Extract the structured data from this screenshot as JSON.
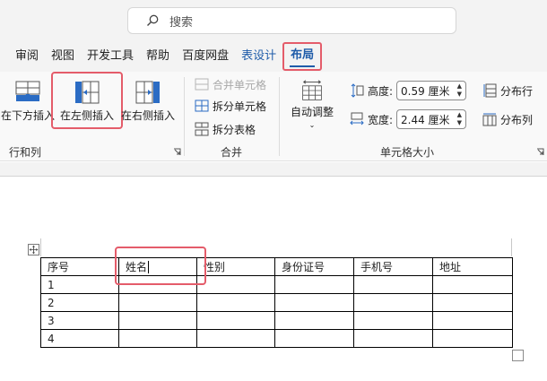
{
  "search": {
    "placeholder": "搜索",
    "icon": "search-icon"
  },
  "tabs": [
    {
      "label": "审阅",
      "state": "normal"
    },
    {
      "label": "视图",
      "state": "normal"
    },
    {
      "label": "开发工具",
      "state": "normal"
    },
    {
      "label": "帮助",
      "state": "normal"
    },
    {
      "label": "百度网盘",
      "state": "normal"
    },
    {
      "label": "表设计",
      "state": "contextual"
    },
    {
      "label": "布局",
      "state": "active"
    }
  ],
  "ribbon": {
    "rows_cols": {
      "label": "行和列",
      "insert_below": "在下方插入",
      "insert_left": "在左侧插入",
      "insert_right": "在右侧插入"
    },
    "merge": {
      "label": "合并",
      "merge_cells": "合并单元格",
      "split_cells": "拆分单元格",
      "split_table": "拆分表格"
    },
    "cell_size": {
      "label": "单元格大小",
      "autofit": "自动调整",
      "height_label": "高度:",
      "height_value": "0.59 厘米",
      "width_label": "宽度:",
      "width_value": "2.44 厘米",
      "distribute_rows": "分布行",
      "distribute_cols": "分布列"
    }
  },
  "colors": {
    "accent": "#1f5ca9",
    "highlight": "#e45c6a",
    "icon_blue": "#2b6cc4"
  },
  "table": {
    "header": [
      "序号",
      "姓名",
      "性别",
      "身份证号",
      "手机号",
      "地址"
    ],
    "rows": [
      [
        "1",
        "",
        "",
        "",
        "",
        ""
      ],
      [
        "2",
        "",
        "",
        "",
        "",
        ""
      ],
      [
        "3",
        "",
        "",
        "",
        "",
        ""
      ],
      [
        "4",
        "",
        "",
        "",
        "",
        ""
      ]
    ]
  }
}
